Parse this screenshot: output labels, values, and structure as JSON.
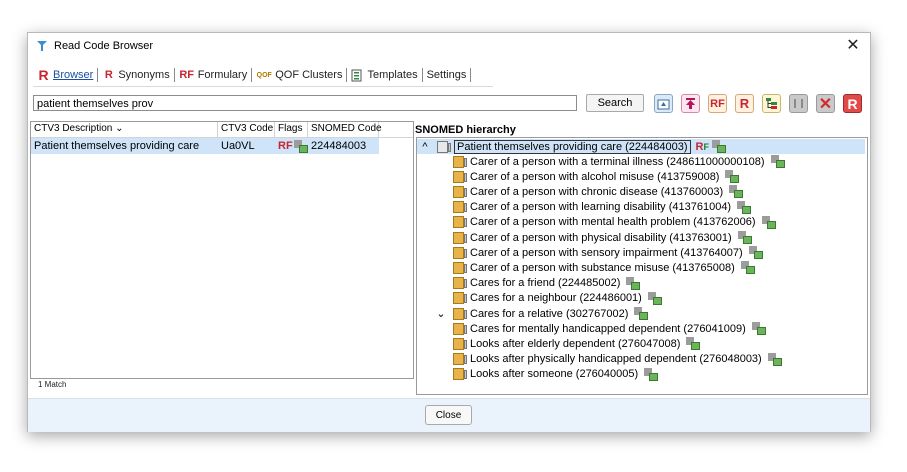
{
  "window": {
    "title": "Read Code Browser",
    "close_glyph": "✕"
  },
  "tabs": [
    {
      "label": "Browser",
      "icon": "R",
      "active": true
    },
    {
      "label": "Synonyms",
      "icon": "R"
    },
    {
      "label": "Formulary",
      "icon": "RF"
    },
    {
      "label": "QOF Clusters",
      "icon": "QOF"
    },
    {
      "label": "Templates",
      "icon": "template-icon"
    },
    {
      "label": "Settings"
    }
  ],
  "search": {
    "value": "patient themselves prov",
    "button_label": "Search"
  },
  "toolbar": {
    "icons": [
      "home-up-icon",
      "top-level-icon",
      "formulary-icon",
      "synonym-icon",
      "hierarchy-icon",
      "split-icon",
      "delete-icon",
      "read-icon"
    ]
  },
  "results": {
    "headers": [
      "CTV3 Description ⌄",
      "CTV3 Code",
      "Flags",
      "SNOMED Code"
    ],
    "rows": [
      {
        "description": "Patient themselves providing care",
        "ctv3": "Ua0VL",
        "flags": "RF",
        "snomed": "224484003"
      }
    ],
    "match_count": "1 Match"
  },
  "hierarchy": {
    "label": "SNOMED hierarchy",
    "root": {
      "text": "Patient themselves providing care (224484003)",
      "chevron": "^"
    },
    "children": [
      "Carer of a person with a terminal illness (248611000000108)",
      "Carer of a person with alcohol misuse (413759008)",
      "Carer of a person with chronic disease (413760003)",
      "Carer of a person with learning disability (413761004)",
      "Carer of a person with mental health problem (413762006)",
      "Carer of a person with physical disability (413763001)",
      "Carer of a person with sensory impairment (413764007)",
      "Carer of a person with substance misuse (413765008)",
      "Cares for a friend (224485002)",
      "Cares for a neighbour (224486001)",
      "Cares for a relative (302767002)",
      "Cares for mentally handicapped dependent (276041009)",
      "Looks after elderly dependent (276047008)",
      "Looks after physically handicapped dependent (276048003)",
      "Looks after someone (276040005)"
    ],
    "expanded_chevron": "⌄"
  },
  "footer": {
    "close_label": "Close"
  },
  "colors": {
    "accent": "#1a4ea0",
    "selection": "#cfe4f8",
    "danger": "#c6262e"
  }
}
